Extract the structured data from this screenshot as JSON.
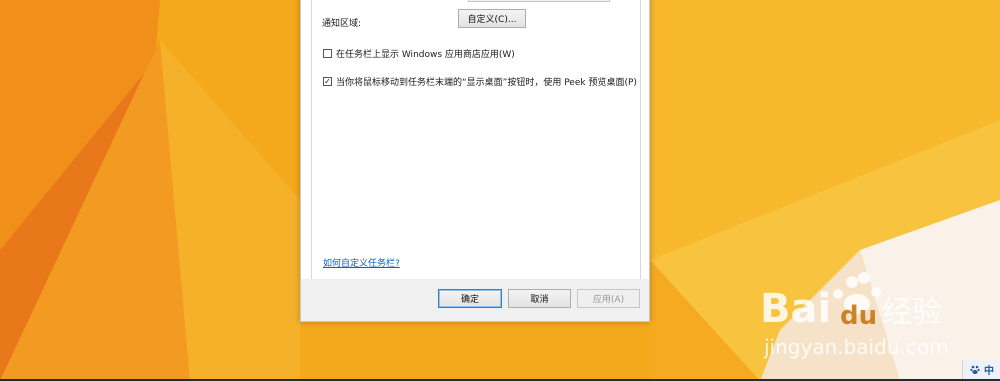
{
  "dialog": {
    "notification_area_label": "通知区域:",
    "customize_button": "自定义(C)...",
    "show_store_apps_label": "在任务栏上显示 Windows 应用商店应用(W)",
    "show_store_apps_checked": false,
    "peek_label": "当你将鼠标移动到任务栏末端的“显示桌面”按钮时，使用 Peek 预览桌面(P)",
    "peek_checked": true,
    "help_link": "如何自定义任务栏?",
    "ok_button": "确定",
    "cancel_button": "取消",
    "apply_button": "应用(A)"
  },
  "watermark": {
    "brand": "Bai du 经验",
    "url": "jingyan.baidu.com"
  },
  "taskbar": {
    "ime_mode": "中",
    "ime_icon": "paw-icon"
  },
  "colors": {
    "wallpaper_base": "#f4a81c",
    "link": "#0b63c2",
    "accent_button_border": "#3c7fb1"
  }
}
